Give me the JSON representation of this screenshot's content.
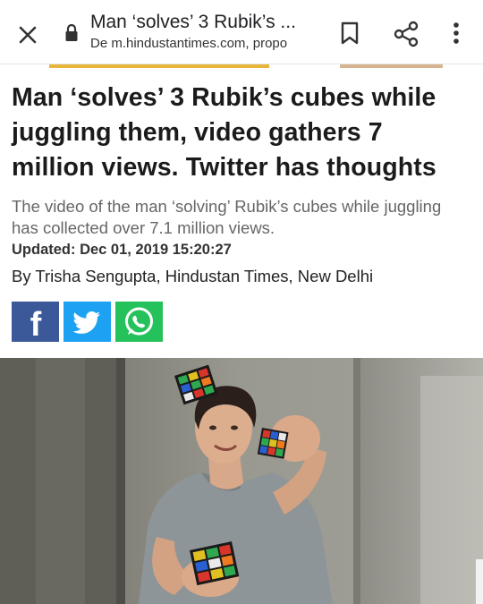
{
  "browser": {
    "page_title": "Man ‘solves’ 3 Rubik’s ...",
    "url_text": "De m.hindustantimes.com, propo"
  },
  "article": {
    "headline": "Man ‘solves’ 3 Rubik’s cubes while juggling them, video gathers 7 million views. Twitter has thoughts",
    "summary": "The video of the man ‘solving’ Rubik’s cubes while juggling has collected over 7.1 million views.",
    "updated": "Updated: Dec 01, 2019 15:20:27",
    "byline": "By Trisha Sengupta, Hindustan Times, New Delhi"
  },
  "share": {
    "facebook_glyph": "f"
  },
  "icons": {
    "close": "close-icon",
    "lock": "lock-icon",
    "bookmark": "bookmark-icon",
    "share": "share-icon",
    "more": "more-vert-icon",
    "facebook": "facebook-icon",
    "twitter": "twitter-icon",
    "whatsapp": "whatsapp-icon"
  },
  "colors": {
    "facebook": "#3b5998",
    "twitter": "#1da1f2",
    "whatsapp": "#25c15a",
    "accent_strip": "#e8b53a"
  }
}
